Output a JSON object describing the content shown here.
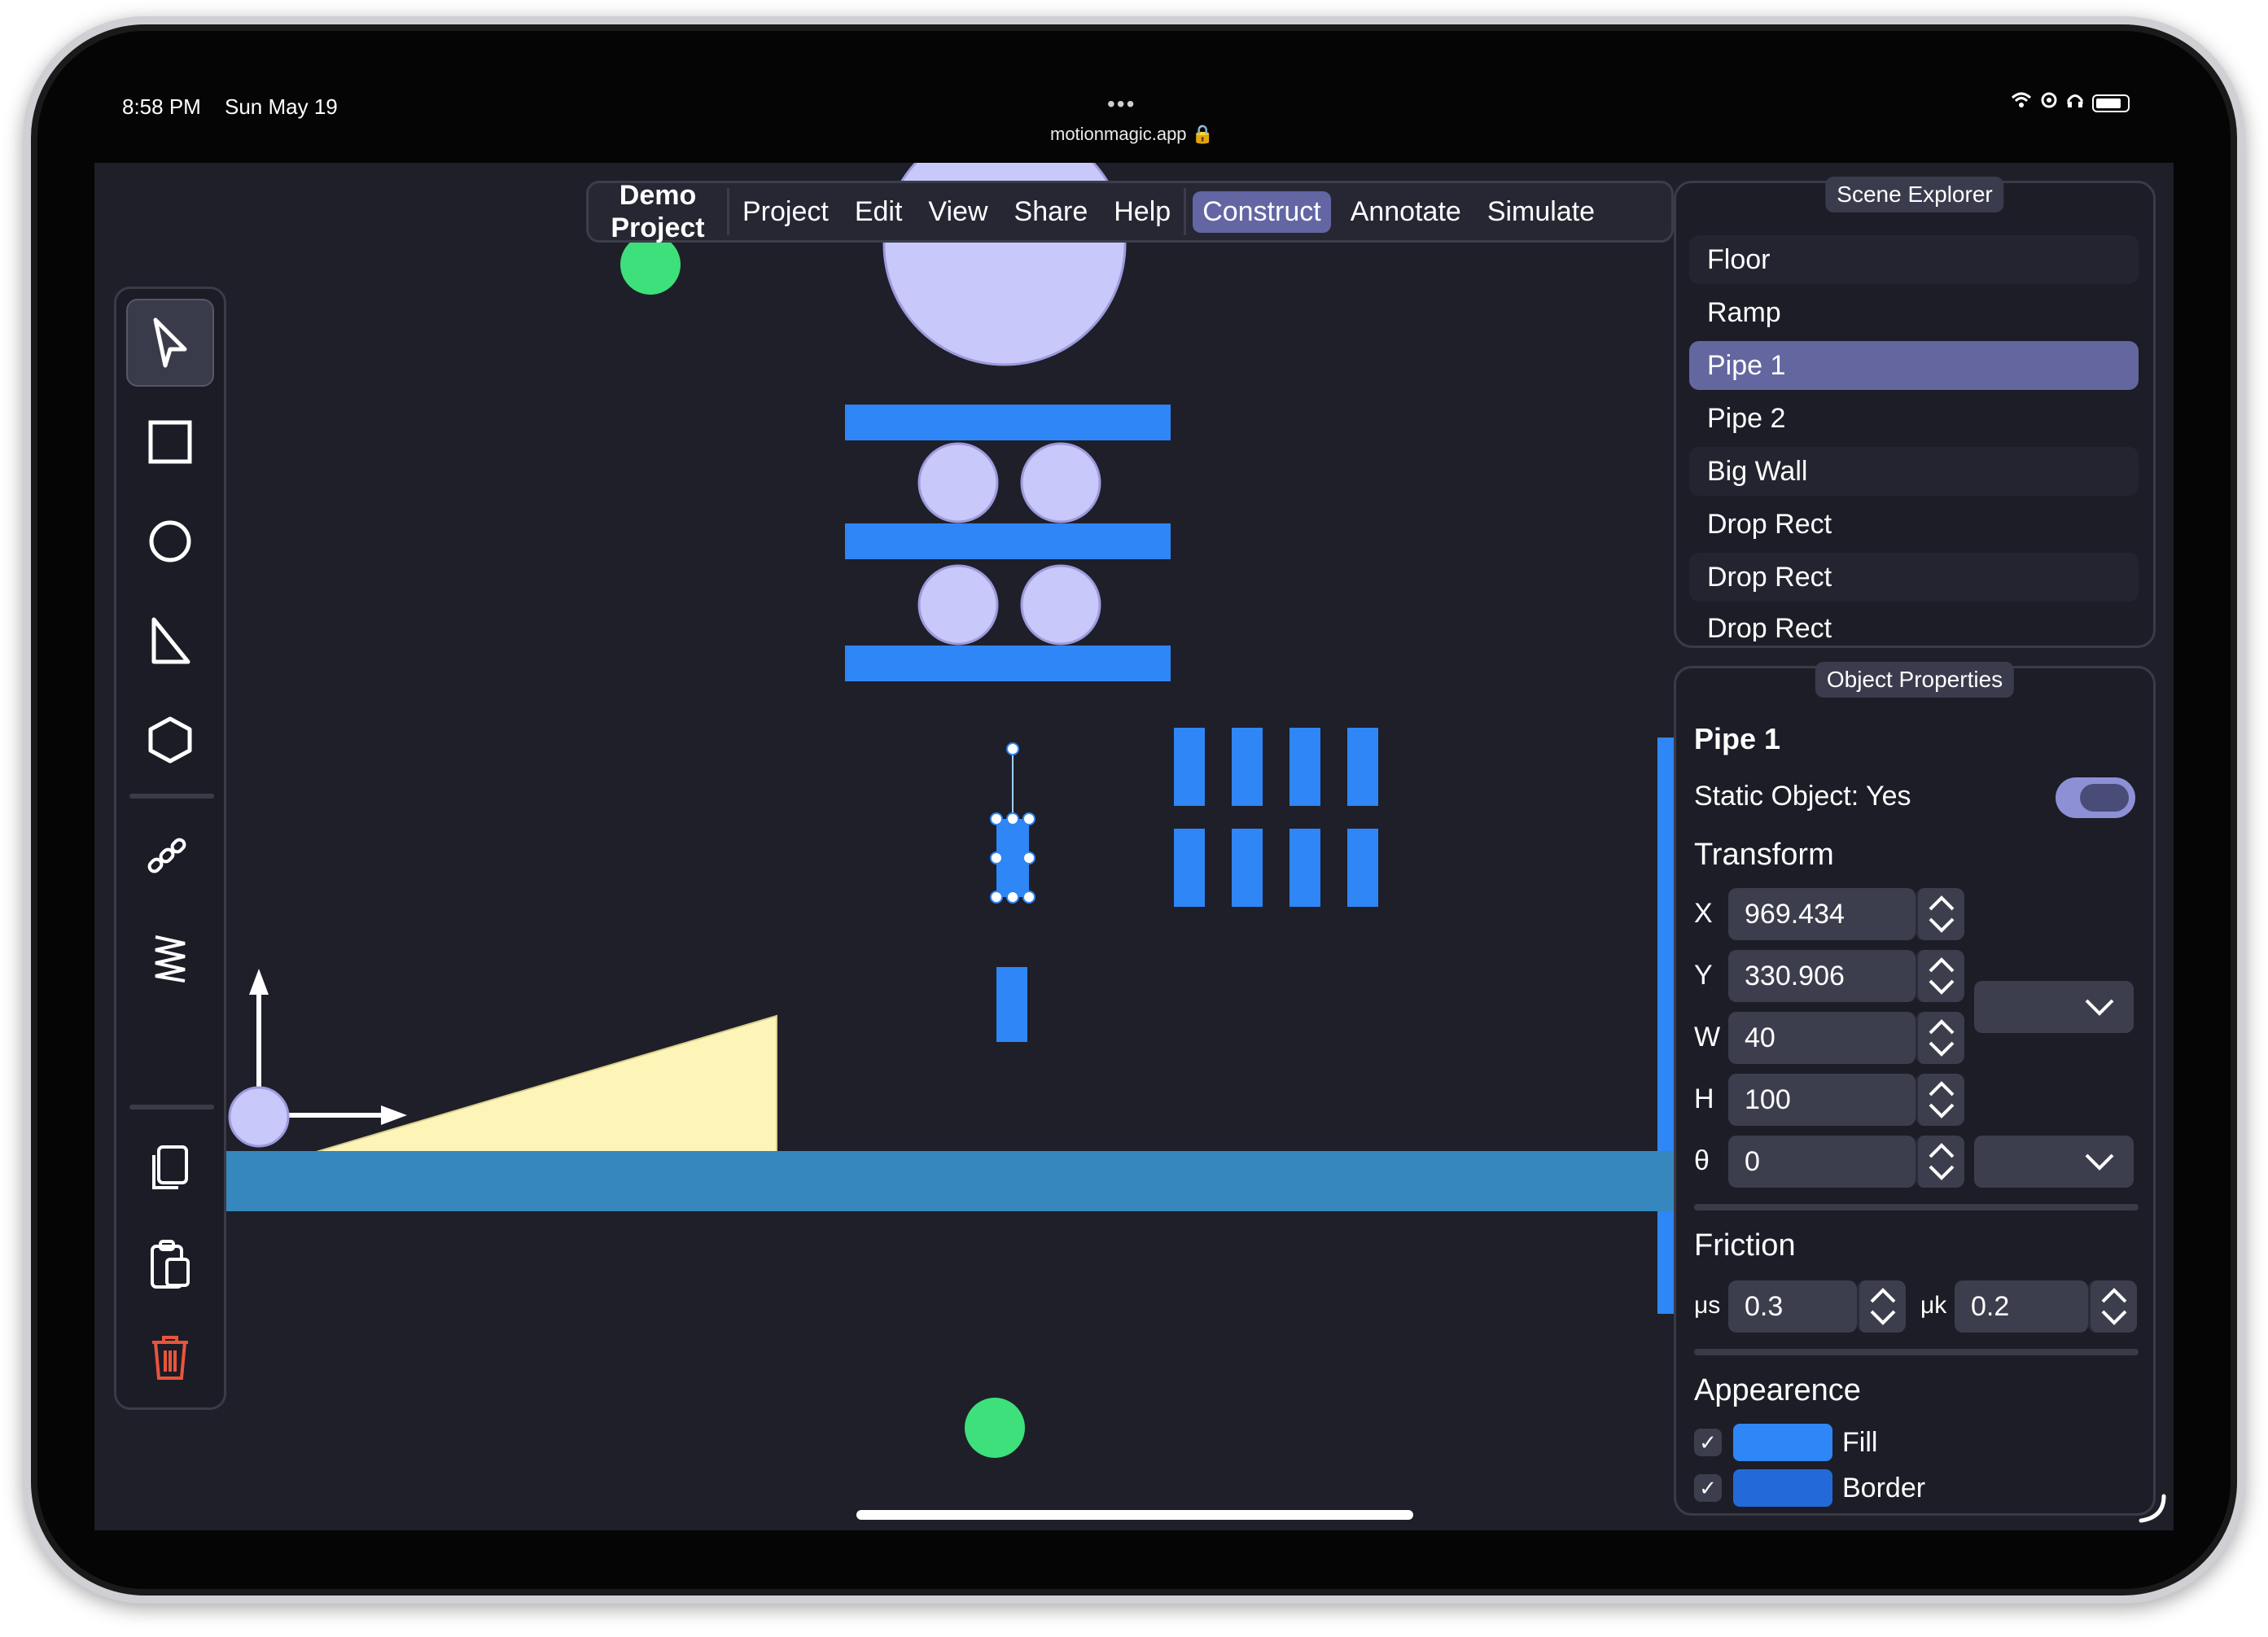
{
  "status_bar": {
    "time": "8:58 PM",
    "date": "Sun May 19",
    "url": "motionmagic.app",
    "dots": "•••"
  },
  "menu": {
    "project_title_line1": "Demo",
    "project_title_line2": "Project",
    "items": [
      "Project",
      "Edit",
      "View",
      "Share",
      "Help"
    ],
    "modes": [
      "Construct",
      "Annotate",
      "Simulate"
    ],
    "active_mode": "Construct"
  },
  "tools": [
    "pointer-icon",
    "rectangle-icon",
    "circle-icon",
    "triangle-icon",
    "hexagon-icon",
    "rope-icon",
    "spring-icon",
    "copy-icon",
    "paste-icon",
    "trash-icon"
  ],
  "scene_explorer": {
    "title": "Scene Explorer",
    "items": [
      "Floor",
      "Ramp",
      "Pipe 1",
      "Pipe 2",
      "Big Wall",
      "Drop Rect",
      "Drop Rect",
      "Drop Rect"
    ],
    "selected": "Pipe 1"
  },
  "object_properties": {
    "title": "Object Properties",
    "name": "Pipe 1",
    "static_label": "Static Object: Yes",
    "transform_label": "Transform",
    "x_label": "X",
    "x_value": "969.434",
    "y_label": "Y",
    "y_value": "330.906",
    "w_label": "W",
    "w_value": "40",
    "h_label": "H",
    "h_value": "100",
    "theta_label": "θ",
    "theta_value": "0",
    "friction_label": "Friction",
    "mu_s_label": "μs",
    "mu_s_value": "0.3",
    "mu_k_label": "μk",
    "mu_k_value": "0.2",
    "appearance_label": "Appearence",
    "fill_label": "Fill",
    "border_label": "Border"
  },
  "colors": {
    "canvas_bg": "#1e1f29",
    "block_blue": "#2f86f6",
    "ball_lavender": "#c9c8fb",
    "ball_green": "#3de07a",
    "floor": "#3687bd",
    "ramp": "#fdf5b8",
    "selection_accent": "#6466a0",
    "fill_swatch": "#2f86f6",
    "border_swatch": "#2469d9"
  }
}
